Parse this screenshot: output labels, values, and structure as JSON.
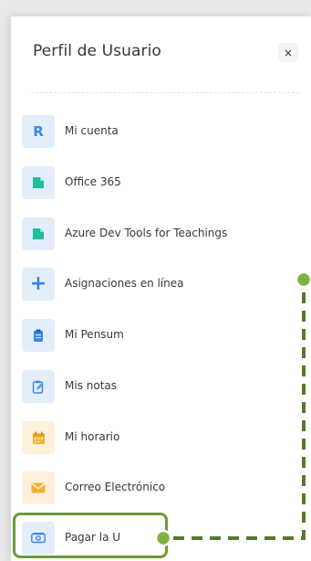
{
  "panel": {
    "title": "Perfil de Usuario",
    "close_label": "×"
  },
  "menu": [
    {
      "label": "Mi cuenta",
      "icon": "letter-r-icon",
      "icon_text": "R",
      "tone": "blue"
    },
    {
      "label": "Office 365",
      "icon": "document-icon",
      "tone": "blue"
    },
    {
      "label": "Azure Dev Tools for Teachings",
      "icon": "document-icon",
      "tone": "blue"
    },
    {
      "label": "Asignaciones en línea",
      "icon": "plus-icon",
      "icon_text": "+",
      "tone": "blue"
    },
    {
      "label": "Mi Pensum",
      "icon": "clipboard-icon",
      "tone": "blue"
    },
    {
      "label": "Mis notas",
      "icon": "edit-notes-icon",
      "tone": "blue"
    },
    {
      "label": "Mi horario",
      "icon": "calendar-icon",
      "tone": "orange"
    },
    {
      "label": "Correo Electrónico",
      "icon": "envelope-icon",
      "tone": "orange"
    },
    {
      "label": "Pagar la U",
      "icon": "money-icon",
      "tone": "blue"
    }
  ],
  "colors": {
    "accent_blue": "#3a86e6",
    "accent_orange": "#f5b230",
    "tile_blue": "#e3eefb",
    "tile_orange": "#fdf1dc",
    "highlight_green": "#6d9a3a",
    "connector_dot": "#7cb342"
  }
}
